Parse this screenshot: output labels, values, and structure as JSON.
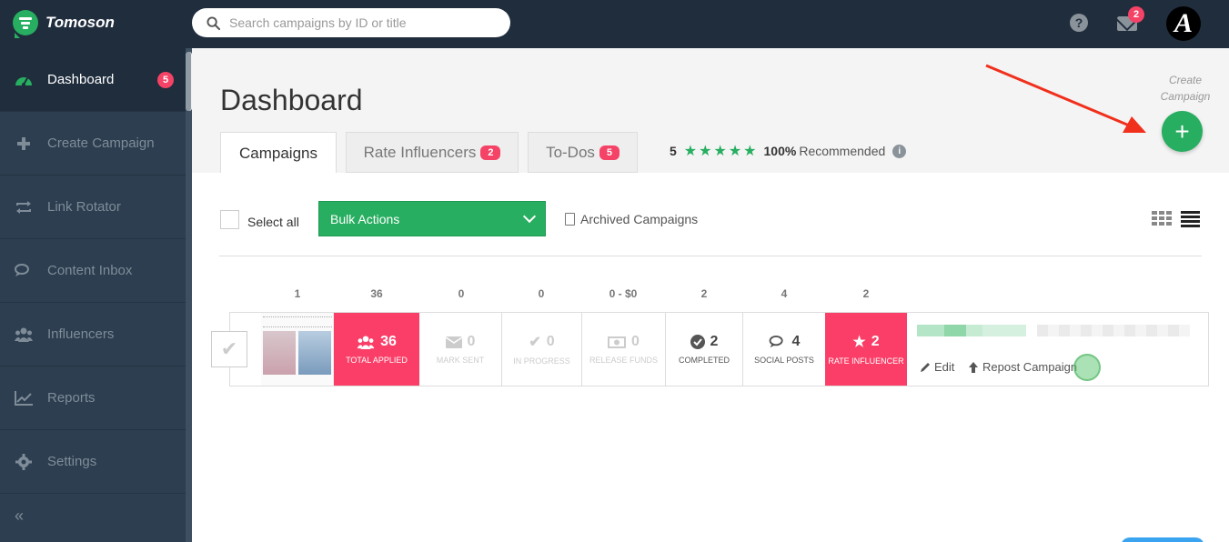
{
  "app": {
    "name": "Tomoson"
  },
  "search": {
    "placeholder": "Search campaigns by ID or title"
  },
  "topbar": {
    "help_icon": "question-circle-icon",
    "mail_icon": "envelope-icon",
    "mail_badge": "2",
    "avatar_letter": "A"
  },
  "sidebar": {
    "items": [
      {
        "label": "Dashboard",
        "icon": "dashboard-icon",
        "badge": "5",
        "active": true
      },
      {
        "label": "Create Campaign",
        "icon": "plus-icon"
      },
      {
        "label": "Link Rotator",
        "icon": "retweet-icon"
      },
      {
        "label": "Content Inbox",
        "icon": "comments-icon"
      },
      {
        "label": "Influencers",
        "icon": "users-icon"
      },
      {
        "label": "Reports",
        "icon": "line-chart-icon"
      },
      {
        "label": "Settings",
        "icon": "gear-icon"
      }
    ],
    "collapse_label": "«"
  },
  "page": {
    "title": "Dashboard"
  },
  "tabs": [
    {
      "label": "Campaigns",
      "active": true
    },
    {
      "label": "Rate Influencers",
      "badge": "2"
    },
    {
      "label": "To-Dos",
      "badge": "5"
    }
  ],
  "rating": {
    "count": "5",
    "stars": "★★★★★",
    "percent": "100%",
    "label": "Recommended"
  },
  "create": {
    "label": "Create Campaign",
    "button": "+"
  },
  "toolbar": {
    "select_all": "Select all",
    "bulk_actions": "Bulk Actions",
    "archived": "Archived Campaigns"
  },
  "campaign": {
    "column_counts": [
      "1",
      "36",
      "0",
      "0",
      "0 - $0",
      "2",
      "4",
      "2"
    ],
    "stats": [
      {
        "value": "36",
        "label": "TOTAL APPLIED",
        "icon": "users-icon"
      },
      {
        "value": "0",
        "label": "MARK SENT",
        "icon": "envelope-icon"
      },
      {
        "value": "0",
        "label": "IN PROGRESS",
        "icon": "check-icon"
      },
      {
        "value": "0",
        "label": "RELEASE FUNDS",
        "icon": "money-icon"
      },
      {
        "value": "2",
        "label": "COMPLETED",
        "icon": "check-circle-icon"
      },
      {
        "value": "4",
        "label": "SOCIAL POSTS",
        "icon": "comments-icon"
      },
      {
        "value": "2",
        "label": "RATE INFLUENCER",
        "icon": "star-icon"
      }
    ],
    "actions": {
      "edit": "Edit",
      "repost": "Repost Campaign"
    }
  },
  "colors": {
    "brand_green": "#27ae60",
    "badge_red": "#f44366",
    "stat_pink": "#fb3e67",
    "sidebar": "#2c3e50",
    "topbar": "#1f2d3d"
  }
}
